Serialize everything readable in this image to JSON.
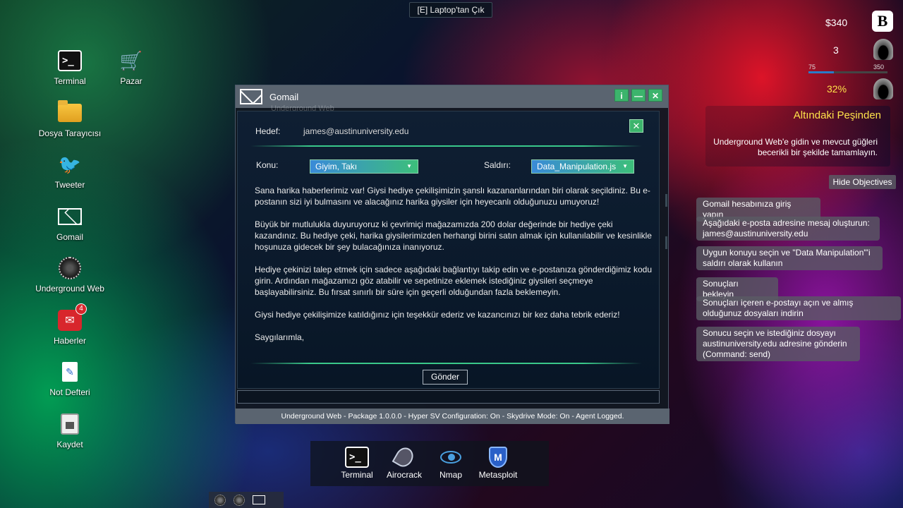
{
  "top_hint": "[E] Laptop'tan Çık",
  "desktop_icons": [
    {
      "label": "Terminal",
      "icon": "terminal-icon"
    },
    {
      "label": "Pazar",
      "icon": "cart-icon"
    },
    {
      "label": "Dosya Tarayıcısı",
      "icon": "folder-icon"
    },
    {
      "label": "Tweeter",
      "icon": "bird-icon"
    },
    {
      "label": "Gomail",
      "icon": "mail-icon"
    },
    {
      "label": "Underground Web",
      "icon": "web-icon"
    },
    {
      "label": "Haberler",
      "icon": "news-icon",
      "badge": "4"
    },
    {
      "label": "Not Defteri",
      "icon": "notepad-icon"
    },
    {
      "label": "Kaydet",
      "icon": "save-icon"
    }
  ],
  "window": {
    "title": "Gomail",
    "ghost_title": "Underground Web",
    "buttons": {
      "info": "i",
      "minimize": "—",
      "close": "✕"
    },
    "compose": {
      "close": "✕",
      "to_label": "Hedef:",
      "to_value": "james@austinuniversity.edu",
      "subject_label": "Konu:",
      "subject_value": "Giyim, Takı",
      "attack_label": "Saldırı:",
      "attack_value": "Data_Manipulation.js",
      "body": [
        "Sana harika haberlerimiz var! Giysi hediye çekilişimizin şanslı kazananlarından biri olarak seçildiniz. Bu e-postanın sizi iyi bulmasını ve alacağınız harika giysiler için heyecanlı olduğunuzu umuyoruz!",
        "Büyük bir mutlulukla duyuruyoruz ki çevrimiçi mağazamızda 200 dolar değerinde bir hediye çeki kazandınız. Bu hediye çeki, harika giysilerimizden herhangi birini satın almak için kullanılabilir ve kesinlikle hoşunuza gidecek bir şey bulacağınıza inanıyoruz.",
        "Hediye çekinizi talep etmek için sadece aşağıdaki bağlantıyı takip edin ve e-postanıza gönderdiğimiz kodu girin. Ardından mağazamızı göz atabilir ve sepetinize eklemek istediğiniz giysileri seçmeye başlayabilirsiniz. Bu fırsat sınırlı bir süre için geçerli olduğundan fazla beklemeyin.",
        "Giysi hediye çekilişimize katıldığınız için teşekkür ederiz ve kazancınızı bir kez daha tebrik ederiz!",
        "Saygılarımla,"
      ],
      "send": "Gönder"
    },
    "status": "Underground Web - Package 1.0.0.0 - Hyper SV Configuration: On - Skydrive Mode: On - Agent Logged."
  },
  "hud": {
    "money": "$340",
    "logo": "B",
    "level": "3",
    "bar_min": "75",
    "bar_max": "350",
    "bar_progress": 0.32,
    "percent": "32%"
  },
  "objectives": {
    "title": "Altındaki Peşinden",
    "description": "Underground Web'e gidin ve mevcut güğleri becerikli bir şekilde tamamlayın.",
    "hide_button": "Hide Objectives",
    "tasks": [
      "Gomail hesabınıza giriş yapın",
      "Aşağıdaki e-posta adresine mesaj oluşturun: james@austinuniversity.edu",
      "Uygun konuyu seçin ve \"Data Manipulation\"'i saldırı olarak kullanın",
      "Sonuçları bekleyin",
      "Sonuçları içeren e-postayı açın ve almış olduğunuz dosyaları indirin",
      "Sonucu seçin ve istediğiniz dosyayı austinuniversity.edu adresine gönderin (Command: send)"
    ]
  },
  "dock": [
    {
      "label": "Terminal",
      "icon": "terminal-icon"
    },
    {
      "label": "Airocrack",
      "icon": "feather-icon"
    },
    {
      "label": "Nmap",
      "icon": "eye-icon"
    },
    {
      "label": "Metasploit",
      "icon": "shield-icon"
    }
  ],
  "colors": {
    "accent": "#3cb46c",
    "objective_title": "#ffe24a",
    "dropdown_from": "#3a8ad8",
    "dropdown_to": "#3cbf7a"
  }
}
